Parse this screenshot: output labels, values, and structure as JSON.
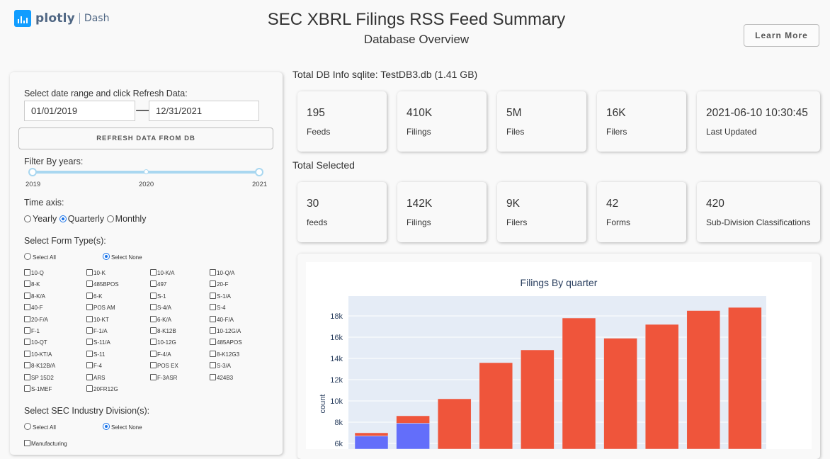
{
  "header": {
    "logo_text": "plotly",
    "logo_dash": "Dash",
    "title": "SEC XBRL Filings RSS Feed Summary",
    "subtitle": "Database Overview",
    "learn_more": "Learn More"
  },
  "sidebar": {
    "date_label": "Select date range and click Refresh Data:",
    "start_date": "01/01/2019",
    "end_date": "12/31/2021",
    "refresh_label": "REFRESH DATA FROM DB",
    "filter_years_label": "Filter By years:",
    "year_ticks": [
      "2019",
      "2020",
      "2021"
    ],
    "time_axis_label": "Time axis:",
    "time_axis_options": [
      "Yearly",
      "Quarterly",
      "Monthly"
    ],
    "time_axis_selected": "Quarterly",
    "form_type_label": "Select Form Type(s):",
    "select_all": "Select All",
    "select_none": "Select None",
    "form_types": [
      "10-Q",
      "10-K",
      "10-K/A",
      "10-Q/A",
      "8-K",
      "485BPOS",
      "497",
      "20-F",
      "8-K/A",
      "6-K",
      "S-1",
      "S-1/A",
      "40-F",
      "POS AM",
      "S-4/A",
      "S-4",
      "20-F/A",
      "10-KT",
      "6-K/A",
      "40-F/A",
      "F-1",
      "F-1/A",
      "8-K12B",
      "10-12G/A",
      "10-QT",
      "S-11/A",
      "10-12G",
      "485APOS",
      "10-KT/A",
      "S-11",
      "F-4/A",
      "8-K12G3",
      "8-K12B/A",
      "F-4",
      "POS EX",
      "S-3/A",
      "SP 15D2",
      "ARS",
      "F-3ASR",
      "424B3",
      "S-1MEF",
      "20FR12G"
    ],
    "industry_label": "Select SEC Industry Division(s):",
    "industry_select_all": "Select All",
    "industry_select_none": "Select None",
    "industry_first": "Manufacturing"
  },
  "total_db": {
    "title": "Total DB Info sqlite: TestDB3.db (1.41 GB)",
    "cards": [
      {
        "value": "195",
        "caption": "Feeds"
      },
      {
        "value": "410K",
        "caption": "Filings"
      },
      {
        "value": "5M",
        "caption": "Files"
      },
      {
        "value": "16K",
        "caption": "Filers"
      },
      {
        "value": "2021-06-10 10:30:45",
        "caption": "Last Updated"
      }
    ]
  },
  "total_selected": {
    "title": "Total Selected",
    "cards": [
      {
        "value": "30",
        "caption": "feeds"
      },
      {
        "value": "142K",
        "caption": "Filings"
      },
      {
        "value": "9K",
        "caption": "Filers"
      },
      {
        "value": "42",
        "caption": "Forms"
      },
      {
        "value": "420",
        "caption": "Sub-Division Classifications"
      }
    ]
  },
  "colors": {
    "series_blue": "#636efa",
    "series_red": "#ef553b",
    "plot_bg": "#e5ecf6"
  },
  "chart_data": {
    "type": "bar",
    "title": "Filings By quarter",
    "ylabel": "count",
    "ytick_labels": [
      "6k",
      "8k",
      "10k",
      "12k",
      "14k",
      "16k",
      "18k"
    ],
    "series": [
      {
        "values": [
          6700,
          7900,
          0,
          0,
          0,
          0,
          0,
          0,
          0,
          0
        ]
      },
      {
        "values": [
          300,
          700,
          10200,
          13600,
          14800,
          17800,
          15900,
          17200,
          18500,
          18800
        ]
      }
    ],
    "ylim": [
      5000,
      19500
    ],
    "grid": true
  }
}
